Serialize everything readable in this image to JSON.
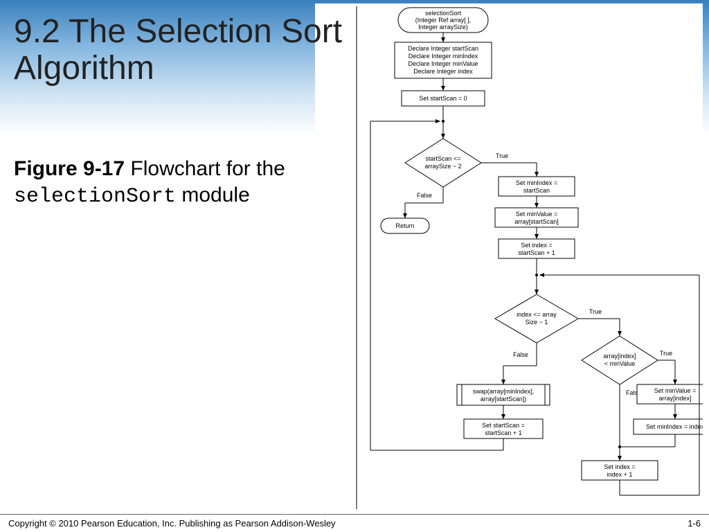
{
  "title": "9.2  The Selection Sort Algorithm",
  "caption": {
    "prefix_bold": "Figure 9-17",
    "text1": "  Flowchart for the ",
    "mono": "selectionSort",
    "text2": " module"
  },
  "footer": {
    "copyright": "Copyright © 2010 Pearson Education, Inc. Publishing as Pearson Addison-Wesley",
    "page": "1-6"
  },
  "flow": {
    "start": {
      "l1": "selectionSort",
      "l2": "(Integer Ref array[ ],",
      "l3": "Integer arraySize)"
    },
    "declare": {
      "l1": "Declare Integer startScan",
      "l2": "Declare Integer minIndex",
      "l3": "Declare Integer minValue",
      "l4": "Declare Integer index"
    },
    "setstart0": "Set startScan = 0",
    "cond1": {
      "l1": "startScan <=",
      "l2": "arraySize − 2"
    },
    "cond1_true": "True",
    "cond1_false": "False",
    "ret": "Return",
    "setminidx": {
      "l1": "Set minIndex =",
      "l2": "startScan"
    },
    "setminval": {
      "l1": "Set minValue =",
      "l2": "array[startScan]"
    },
    "setidx": {
      "l1": "Set index =",
      "l2": "startScan + 1"
    },
    "cond2": {
      "l1": "index <= array",
      "l2": "Size − 1"
    },
    "cond2_true": "True",
    "cond2_false": "False",
    "cond3": {
      "l1": "array[index]",
      "l2": "< minValue"
    },
    "cond3_true": "True",
    "cond3_false": "False",
    "swap": {
      "l1": "swap(array[minIndex],",
      "l2": "array[startScan])"
    },
    "setss1": {
      "l1": "Set startScan =",
      "l2": "startScan + 1"
    },
    "setmv2": {
      "l1": "Set minValue =",
      "l2": "array[index]"
    },
    "setmi2": "Set minIndex = index",
    "setidx2": {
      "l1": "Set index =",
      "l2": "index + 1"
    }
  }
}
